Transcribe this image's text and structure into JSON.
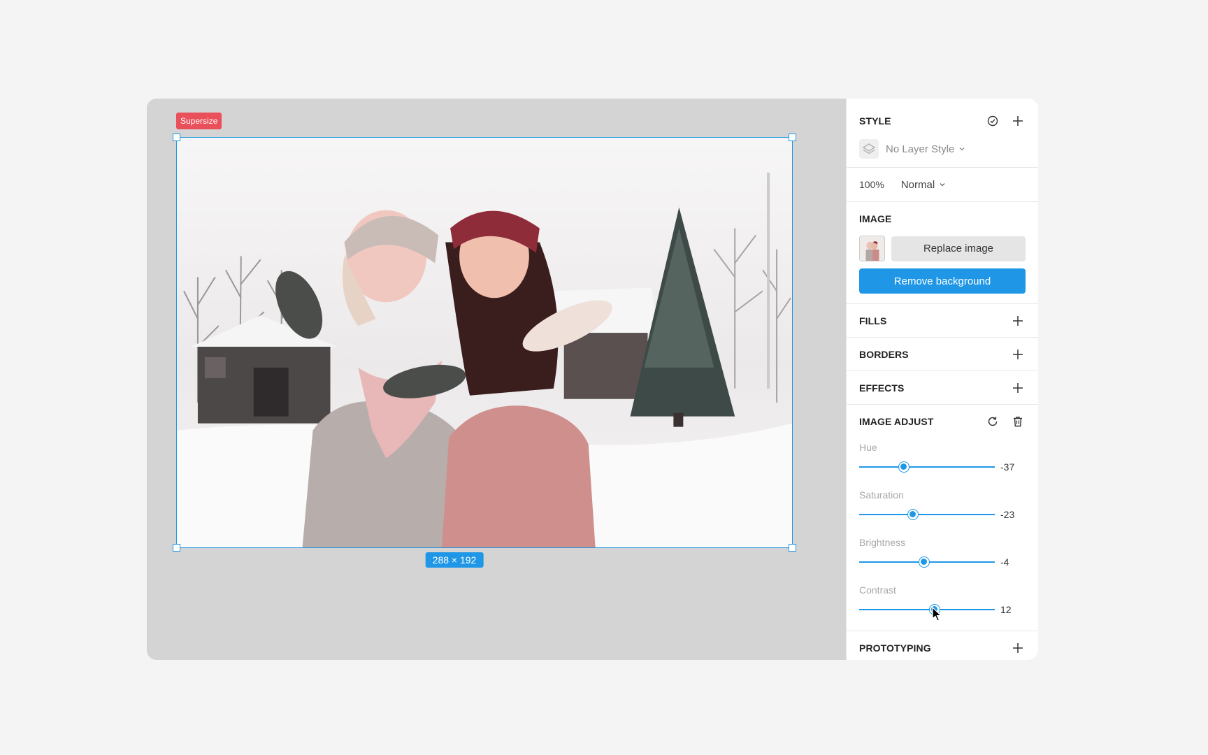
{
  "canvas": {
    "frame_tag": "Supersize",
    "size_badge": "288 × 192"
  },
  "panel": {
    "style": {
      "title": "STYLE",
      "layer_style": "No Layer Style",
      "opacity": "100%",
      "blend_mode": "Normal"
    },
    "image": {
      "title": "IMAGE",
      "replace_label": "Replace image",
      "remove_bg_label": "Remove background"
    },
    "fills": {
      "title": "FILLS"
    },
    "borders": {
      "title": "BORDERS"
    },
    "effects": {
      "title": "EFFECTS"
    },
    "image_adjust": {
      "title": "IMAGE ADJUST",
      "sliders": [
        {
          "label": "Hue",
          "value": "-37",
          "fraction": 0.33
        },
        {
          "label": "Saturation",
          "value": "-23",
          "fraction": 0.395
        },
        {
          "label": "Brightness",
          "value": "-4",
          "fraction": 0.48
        },
        {
          "label": "Contrast",
          "value": "12",
          "fraction": 0.555
        }
      ]
    },
    "prototyping": {
      "title": "PROTOTYPING"
    }
  },
  "colors": {
    "accent": "#1f97e6",
    "tag": "#e9505a"
  },
  "icons": [
    "check-circle-icon",
    "plus-icon",
    "layers-icon",
    "chevron-down-icon",
    "reset-icon",
    "trash-icon",
    "cursor-icon"
  ]
}
